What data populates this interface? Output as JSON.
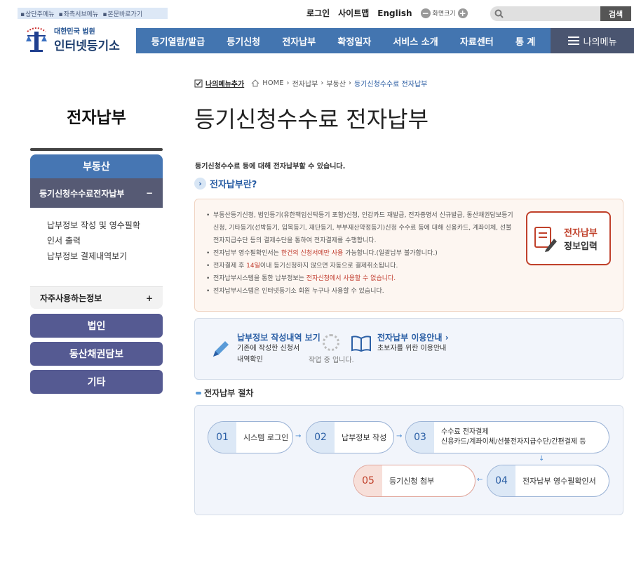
{
  "skip_links": [
    "상단주메뉴",
    "좌측서브메뉴",
    "본문바로가기"
  ],
  "util": {
    "login": "로그인",
    "sitemap": "사이트맵",
    "english": "English",
    "zoom_label": "화면크기",
    "zoom_minus": "−",
    "zoom_plus": "+"
  },
  "search": {
    "placeholder": "",
    "button": "검색"
  },
  "logo": {
    "line1": "대한민국 법원",
    "line2": "인터넷등기소"
  },
  "gnb": [
    "등기열람/발급",
    "등기신청",
    "전자납부",
    "확정일자",
    "서비스 소개",
    "자료센터",
    "통 계"
  ],
  "mymenu": "나의메뉴",
  "lnb": {
    "title": "전자납부",
    "head": "부동산",
    "active": "등기신청수수료전자납부",
    "active_icon": "−",
    "subs": [
      "납부정보 작성 및 영수필확",
      "인서 출력",
      "납부정보 결제내역보기"
    ],
    "fav": "자주사용하는정보",
    "fav_icon": "+",
    "buttons": [
      "법인",
      "동산채권담보",
      "기타"
    ]
  },
  "breadcrumb": {
    "add_fav": "나의메뉴추가",
    "items": [
      "HOME",
      "전자납부",
      "부동산"
    ],
    "current": "등기신청수수료 전자납부"
  },
  "page_title": "등기신청수수료 전자납부",
  "intro": "등기신청수수료 등에 대해 전자납부할 수 있습니다.",
  "section1": "전자납부란?",
  "info": {
    "b1": "부동산등기신청, 법인등기(유한책임신탁등기 포함)신청, 인감카드 재발급, 전자증명서 신규발급, 동산채권담보등기신청, 기타등기(선박등기, 입목등기, 재단등기, 부부재산약정등기)신청 수수료 등에 대해 신용카드, 계좌이체, 선불전자지급수단 등의 결제수단을 통하여 전자결제를 수행합니다.",
    "b2_pre": "전자납부 영수필확인서는 ",
    "b2_red": "한건의 신청서에만 사용",
    "b2_post": " 가능합니다.(일괄납부 불가합니다.)",
    "b3_pre": "전자결제 후 ",
    "b3_red": "14일",
    "b3_post": "이내 등기신청하지 않으면 자동으로 결제취소됩니다.",
    "b4_pre": "전자납부시스템을 통한 납부정보는 ",
    "b4_red": "전자신청에서 사용할 수 없습니다.",
    "b5": "전자납부시스템은 인터넷등기소 회원 누구나 사용할 수 있습니다."
  },
  "paybtn": {
    "line1": "전자납부",
    "line2": "정보입력"
  },
  "links": {
    "l1_title": "납부정보 작성내역 보기",
    "l1_desc1": "기존에 작성한 신청서",
    "l1_desc2": "내역확인",
    "loading": "작업 중 입니다.",
    "l2_title": "전자납부 이용안내",
    "l2_desc": "초보자를 위한 이용안내"
  },
  "section2": "전자납부 절차",
  "steps": [
    {
      "num": "01",
      "label": "시스템 로그인"
    },
    {
      "num": "02",
      "label": "납부정보 작성"
    },
    {
      "num": "03",
      "label": "수수료 전자결제",
      "sub": "신용카드/계좌이체/선불전자지급수단/간편결제 등"
    },
    {
      "num": "04",
      "label": "전자납부 영수필확인서"
    },
    {
      "num": "05",
      "label": "등기신청 첨부"
    }
  ],
  "colors": {
    "nav": "#4375b0",
    "active": "#565a74",
    "accent_red": "#c0412b"
  }
}
